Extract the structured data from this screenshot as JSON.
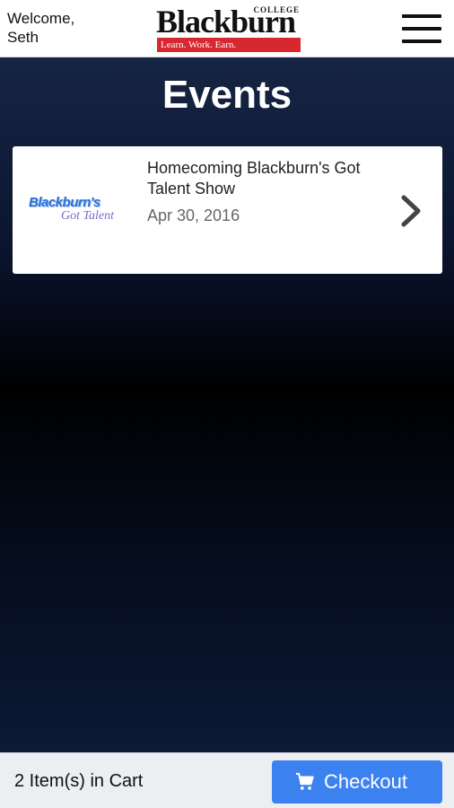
{
  "header": {
    "welcome_line1": "Welcome,",
    "welcome_line2": "Seth",
    "logo": {
      "word": "Blackburn",
      "college": "COLLEGE",
      "tagline": "Learn. Work. Earn."
    },
    "menu_icon": "hamburger-menu-icon"
  },
  "page": {
    "title": "Events"
  },
  "events": [
    {
      "name": "Homecoming Blackburn's Got Talent Show",
      "date": "Apr 30, 2016",
      "thumb_main": "Blackburn's",
      "thumb_sub": "Got Talent"
    }
  ],
  "footer": {
    "cart_text": "2 Item(s) in Cart",
    "checkout_label": "Checkout",
    "cart_icon": "shopping-cart-icon"
  },
  "colors": {
    "accent": "#3b82f0",
    "logo_red": "#d7282f",
    "background_top": "#1a2a4a",
    "background_mid": "#000000"
  }
}
